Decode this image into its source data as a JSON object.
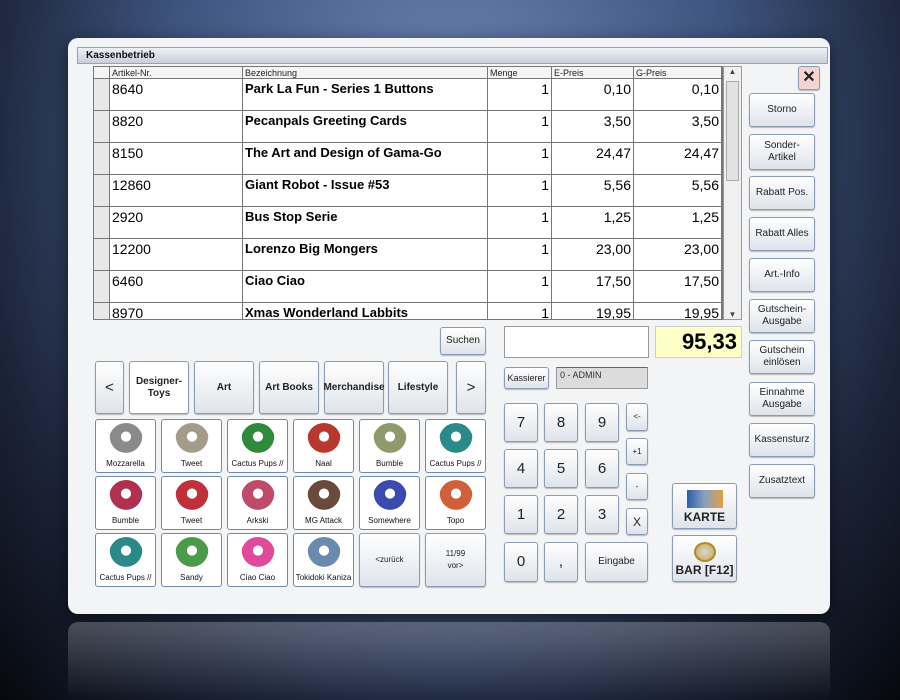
{
  "window": {
    "title": "Kassenbetrieb",
    "close_label": "✕"
  },
  "table": {
    "columns": [
      "Artikel-Nr.",
      "Bezeichnung",
      "Menge",
      "E-Preis",
      "G-Preis"
    ],
    "rows": [
      {
        "nr": "8640",
        "name": "Park La Fun - Series 1 Buttons",
        "qty": "1",
        "ep": "0,10",
        "gp": "0,10"
      },
      {
        "nr": "8820",
        "name": "Pecanpals Greeting Cards",
        "qty": "1",
        "ep": "3,50",
        "gp": "3,50"
      },
      {
        "nr": "8150",
        "name": "The Art and Design of Gama-Go",
        "qty": "1",
        "ep": "24,47",
        "gp": "24,47"
      },
      {
        "nr": "12860",
        "name": "Giant Robot - Issue #53",
        "qty": "1",
        "ep": "5,56",
        "gp": "5,56"
      },
      {
        "nr": "2920",
        "name": "Bus Stop Serie",
        "qty": "1",
        "ep": "1,25",
        "gp": "1,25"
      },
      {
        "nr": "12200",
        "name": "Lorenzo Big Mongers",
        "qty": "1",
        "ep": "23,00",
        "gp": "23,00"
      },
      {
        "nr": "6460",
        "name": "Ciao Ciao",
        "qty": "1",
        "ep": "17,50",
        "gp": "17,50"
      },
      {
        "nr": "8970",
        "name": "Xmas Wonderland Labbits",
        "qty": "1",
        "ep": "19,95",
        "gp": "19,95"
      }
    ]
  },
  "side_buttons": [
    "Storno",
    "Sonder- Artikel",
    "Rabatt Pos.",
    "Rabatt Alles",
    "Art.-Info",
    "Gutschein-Ausgabe",
    "Gutschein einlösen",
    "Einnahme Ausgabe",
    "Kassensturz",
    "Zusatztext"
  ],
  "search": {
    "label": "Suchen"
  },
  "categories": {
    "prev": "<",
    "next": ">",
    "items": [
      "Designer-Toys",
      "Art",
      "Art Books",
      "Merchandise",
      "Lifestyle"
    ]
  },
  "products": [
    {
      "name": "Mozzarella",
      "color": "#8a8a8a"
    },
    {
      "name": "Tweet",
      "color": "#a59b8a"
    },
    {
      "name": "Cactus Pups //",
      "color": "#2f8a3a"
    },
    {
      "name": "Naal",
      "color": "#b8382f"
    },
    {
      "name": "Bumble",
      "color": "#8f9a6a"
    },
    {
      "name": "Cactus Pups //",
      "color": "#2a8a8a"
    },
    {
      "name": "Bumble",
      "color": "#b03050"
    },
    {
      "name": "Tweet",
      "color": "#c0303a"
    },
    {
      "name": "Arkski",
      "color": "#c04a6a"
    },
    {
      "name": "MG Attack",
      "color": "#6a4a3a"
    },
    {
      "name": "Somewhere",
      "color": "#3a4ab0"
    },
    {
      "name": "Topo",
      "color": "#d0603a"
    },
    {
      "name": "Cactus Pups //",
      "color": "#2a8a8a"
    },
    {
      "name": "Sandy",
      "color": "#4a9a4a"
    },
    {
      "name": "Ciao Ciao",
      "color": "#e04a9a"
    },
    {
      "name": "Tokidoki Kaniza",
      "color": "#6a8ab0"
    }
  ],
  "paging": {
    "back": "<zurück",
    "page": "11/99",
    "forward": "vor>"
  },
  "entry": {
    "value": "",
    "total": "95,33"
  },
  "cashier": {
    "label": "Kassierer",
    "value": "0 - ADMIN"
  },
  "keypad": {
    "keys": [
      "7",
      "8",
      "9",
      "4",
      "5",
      "6",
      "1",
      "2",
      "3",
      "0",
      ",",
      "Eingabe"
    ],
    "side": [
      "<-",
      "+1",
      "-",
      "X"
    ]
  },
  "payment": {
    "card": "KARTE",
    "cash": "BAR [F12]"
  },
  "colors": {
    "total_bg": "#ffffc8"
  }
}
